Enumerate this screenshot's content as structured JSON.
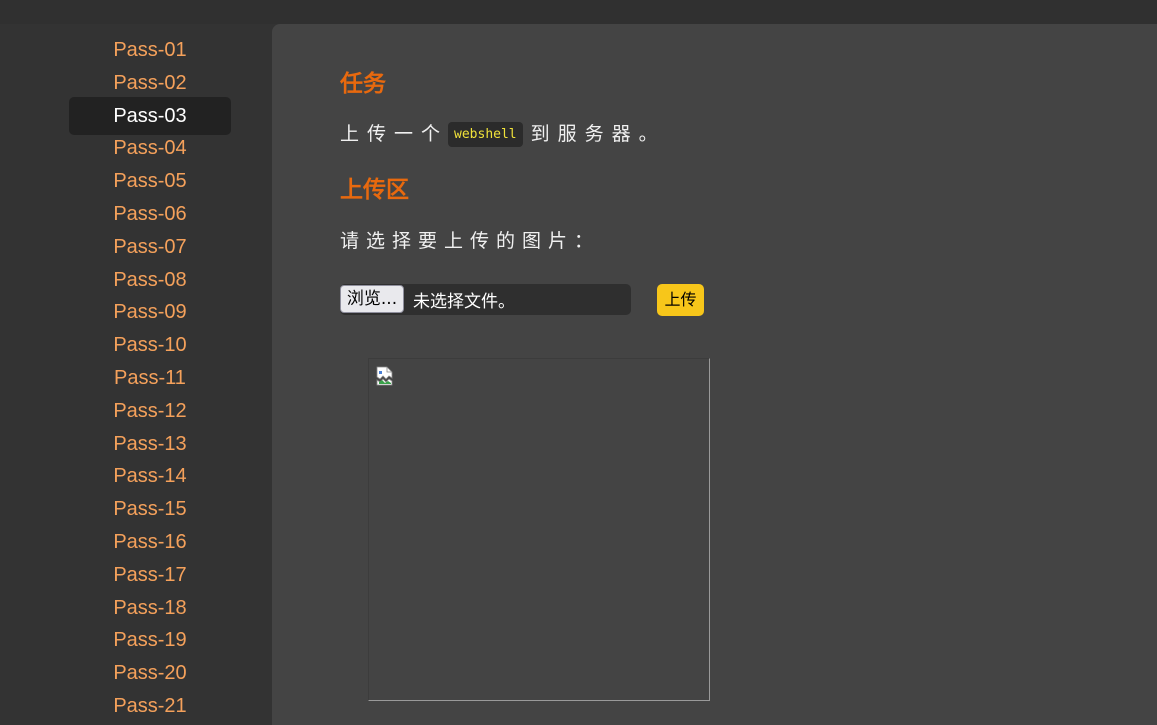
{
  "sidebar": {
    "items": [
      {
        "label": "Pass-01",
        "active": false
      },
      {
        "label": "Pass-02",
        "active": false
      },
      {
        "label": "Pass-03",
        "active": true
      },
      {
        "label": "Pass-04",
        "active": false
      },
      {
        "label": "Pass-05",
        "active": false
      },
      {
        "label": "Pass-06",
        "active": false
      },
      {
        "label": "Pass-07",
        "active": false
      },
      {
        "label": "Pass-08",
        "active": false
      },
      {
        "label": "Pass-09",
        "active": false
      },
      {
        "label": "Pass-10",
        "active": false
      },
      {
        "label": "Pass-11",
        "active": false
      },
      {
        "label": "Pass-12",
        "active": false
      },
      {
        "label": "Pass-13",
        "active": false
      },
      {
        "label": "Pass-14",
        "active": false
      },
      {
        "label": "Pass-15",
        "active": false
      },
      {
        "label": "Pass-16",
        "active": false
      },
      {
        "label": "Pass-17",
        "active": false
      },
      {
        "label": "Pass-18",
        "active": false
      },
      {
        "label": "Pass-19",
        "active": false
      },
      {
        "label": "Pass-20",
        "active": false
      },
      {
        "label": "Pass-21",
        "active": false
      }
    ]
  },
  "main": {
    "task_heading": "任务",
    "task_prefix": "上传一个",
    "task_code": "webshell",
    "task_suffix": "到服务器。",
    "upload_heading": "上传区",
    "prompt": "请选择要上传的图片：",
    "browse_label": "浏览...",
    "file_status": "未选择文件。",
    "upload_label": "上传",
    "preview_icon": "broken-image-icon"
  },
  "colors": {
    "heading": "#e8690e",
    "nav_link": "#f5a15b",
    "upload_button": "#f7c61a",
    "code_text": "#f0e23a"
  }
}
